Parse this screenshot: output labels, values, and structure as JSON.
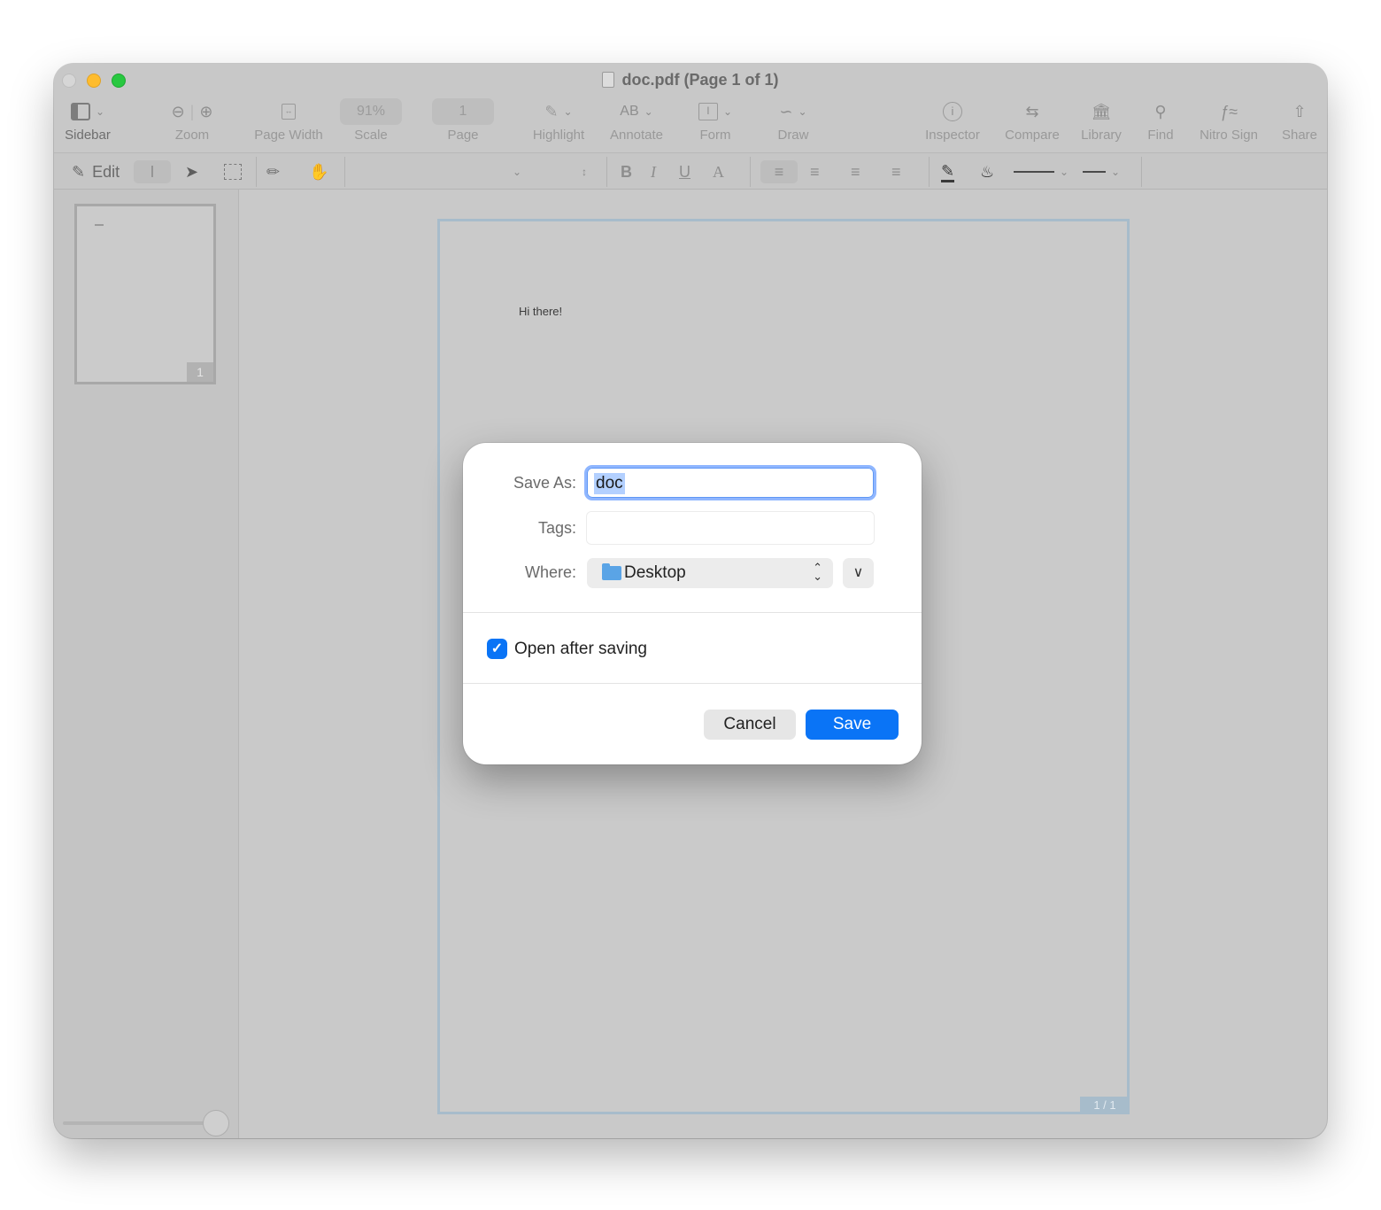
{
  "window": {
    "title": "doc.pdf (Page 1 of 1)"
  },
  "toolbar": {
    "sidebar": "Sidebar",
    "zoom": "Zoom",
    "page_width": "Page Width",
    "scale_value": "91%",
    "scale": "Scale",
    "page_value": "1",
    "page": "Page",
    "highlight": "Highlight",
    "annotate_icon_text": "AB",
    "annotate": "Annotate",
    "form": "Form",
    "draw": "Draw",
    "inspector": "Inspector",
    "compare": "Compare",
    "library": "Library",
    "find": "Find",
    "nitro_sign": "Nitro Sign",
    "share": "Share"
  },
  "formatbar": {
    "edit": "Edit",
    "bold": "B",
    "italic": "I",
    "underline": "U",
    "text_color": "A"
  },
  "sidebar": {
    "thumbnail_page": "1"
  },
  "document": {
    "text": "Hi there!",
    "page_indicator": "1 / 1"
  },
  "dialog": {
    "save_as_label": "Save As:",
    "save_as_value": "doc",
    "tags_label": "Tags:",
    "tags_value": "",
    "where_label": "Where:",
    "where_value": "Desktop",
    "open_after_saving": "Open after saving",
    "open_after_saving_checked": true,
    "cancel": "Cancel",
    "save": "Save"
  },
  "colors": {
    "accent": "#0a74f6",
    "selection": "#b3d0ff",
    "focus_ring": "#8fb6ff"
  }
}
